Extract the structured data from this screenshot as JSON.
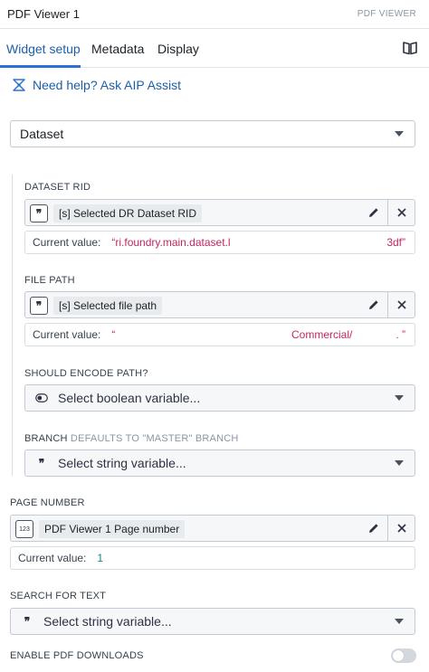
{
  "header": {
    "title": "PDF Viewer 1",
    "widget_type": "PDF VIEWER"
  },
  "tabs": [
    {
      "label": "Widget setup",
      "active": true
    },
    {
      "label": "Metadata",
      "active": false
    },
    {
      "label": "Display",
      "active": false
    }
  ],
  "aip_link": "Need help? Ask AIP Assist",
  "source_select": {
    "value": "Dataset"
  },
  "dataset_rid": {
    "label": "DATASET RID",
    "variable": "[s] Selected DR Dataset RID",
    "current_label": "Current value:",
    "current_value": "“ri.foundry.main.dataset.l",
    "current_value_tail": "3df”"
  },
  "file_path": {
    "label": "FILE PATH",
    "variable": "[s] Selected file path",
    "current_label": "Current value:",
    "current_value_open": "“",
    "current_value_mid": "Commercial/",
    "current_value_tail": ". ”"
  },
  "encode_path": {
    "label": "SHOULD ENCODE PATH?",
    "placeholder": "Select boolean variable..."
  },
  "branch": {
    "label": "BRANCH",
    "sublabel": "DEFAULTS TO \"MASTER\" BRANCH",
    "placeholder": "Select string variable..."
  },
  "page_number": {
    "label": "PAGE NUMBER",
    "icon_text": "123",
    "variable": "PDF Viewer 1 Page number",
    "current_label": "Current value:",
    "current_value": "1"
  },
  "search_text": {
    "label": "SEARCH FOR TEXT",
    "placeholder": "Select string variable..."
  },
  "pdf_downloads": {
    "label": "ENABLE PDF DOWNLOADS",
    "enabled": false
  },
  "colors": {
    "accent": "#2d72d2",
    "link": "#1c5fa8",
    "string_value": "#c22762",
    "number_value": "#0f8a7e"
  }
}
